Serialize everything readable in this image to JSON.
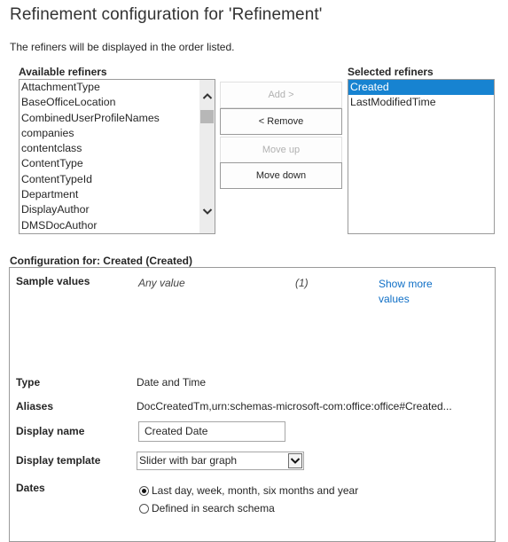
{
  "page": {
    "title": "Refinement configuration for 'Refinement'",
    "subtitle": "The refiners will be displayed in the order listed."
  },
  "available": {
    "label": "Available refiners",
    "items": [
      "AttachmentType",
      "BaseOfficeLocation",
      "CombinedUserProfileNames",
      "companies",
      "contentclass",
      "ContentType",
      "ContentTypeId",
      "Department",
      "DisplayAuthor",
      "DMSDocAuthor"
    ],
    "scroll_up_icon": "chevron-up-icon",
    "scroll_down_icon": "chevron-down-icon"
  },
  "buttons": {
    "add": "Add >",
    "remove": "< Remove",
    "move_up": "Move up",
    "move_down": "Move down"
  },
  "selected": {
    "label": "Selected refiners",
    "items": [
      "Created",
      "LastModifiedTime"
    ],
    "selected_item": "Created"
  },
  "config": {
    "heading": "Configuration for: Created (Created)",
    "sample_values": {
      "label": "Sample values",
      "value": "Any value",
      "count": "(1)",
      "show_more": "Show more values"
    },
    "type": {
      "label": "Type",
      "value": "Date and Time"
    },
    "aliases": {
      "label": "Aliases",
      "value": "DocCreatedTm,urn:schemas-microsoft-com:office:office#Created..."
    },
    "display_name": {
      "label": "Display name",
      "value": "Created Date"
    },
    "display_template": {
      "label": "Display template",
      "value": "Slider with bar graph"
    },
    "dates": {
      "label": "Dates",
      "options": [
        {
          "label": "Last day, week, month, six months and year",
          "checked": true
        },
        {
          "label": "Defined in search schema",
          "checked": false
        }
      ]
    }
  },
  "colors": {
    "selection": "#1783d1",
    "link": "#0f6fc6",
    "border": "#9a9a9a"
  }
}
